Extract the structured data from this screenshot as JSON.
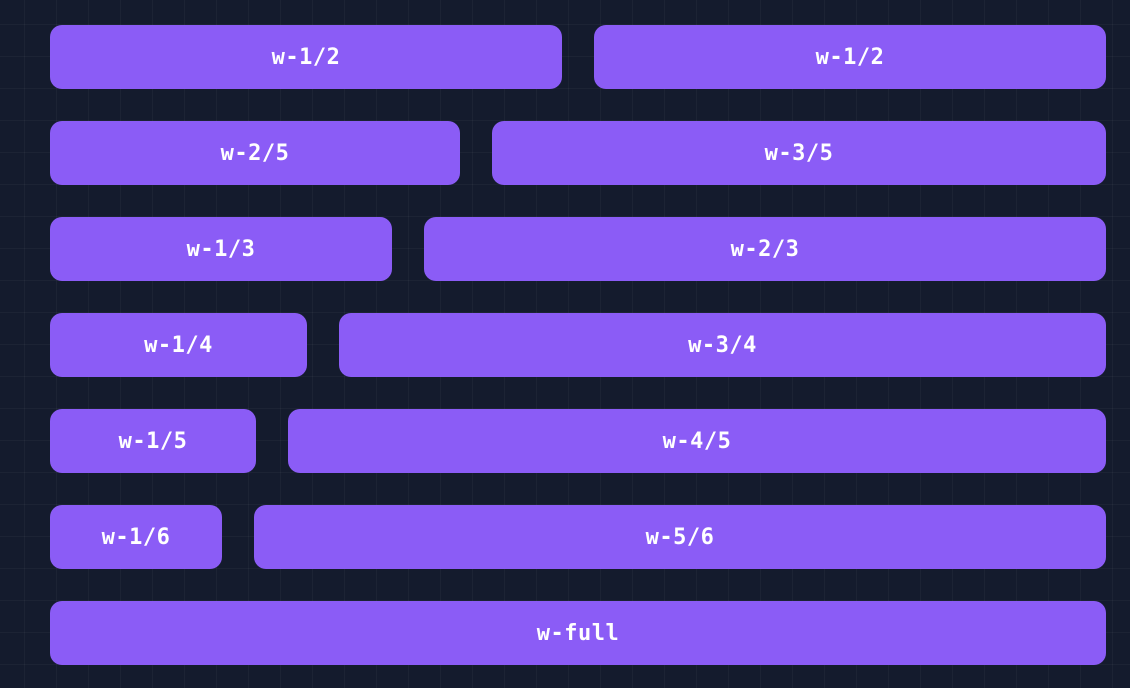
{
  "colors": {
    "background": "#141b2d",
    "bar": "#8b5cf6",
    "text": "#ffffff"
  },
  "rows": [
    {
      "left": "w-1/2",
      "right": "w-1/2"
    },
    {
      "left": "w-2/5",
      "right": "w-3/5"
    },
    {
      "left": "w-1/3",
      "right": "w-2/3"
    },
    {
      "left": "w-1/4",
      "right": "w-3/4"
    },
    {
      "left": "w-1/5",
      "right": "w-4/5"
    },
    {
      "left": "w-1/6",
      "right": "w-5/6"
    }
  ],
  "full": "w-full"
}
